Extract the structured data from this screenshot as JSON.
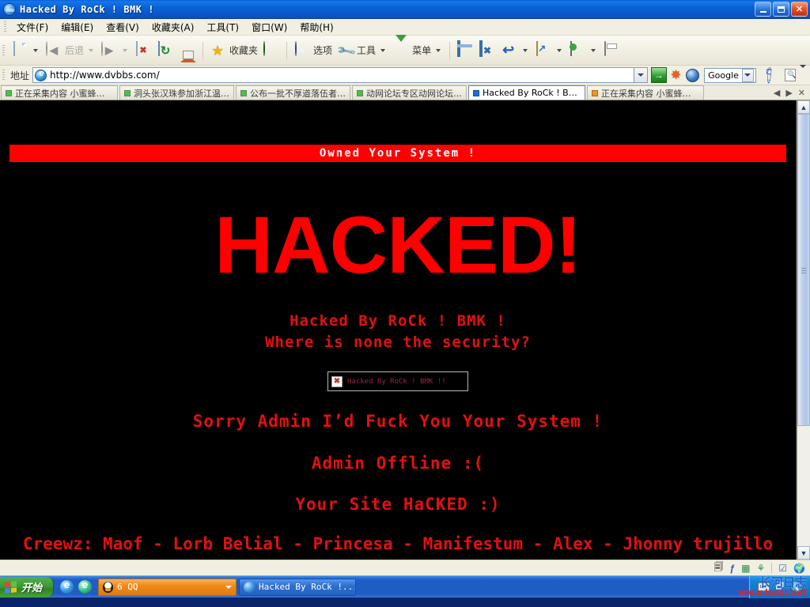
{
  "window": {
    "title": "Hacked By RoCk ! BMK !",
    "icon": "ie-globe-icon",
    "buttons": {
      "minimize": "minimize",
      "maximize": "maximize",
      "close": "close"
    }
  },
  "menubar": {
    "items": [
      {
        "label": "文件(F)"
      },
      {
        "label": "编辑(E)"
      },
      {
        "label": "查看(V)"
      },
      {
        "label": "收藏夹(A)"
      },
      {
        "label": "工具(T)"
      },
      {
        "label": "窗口(W)"
      },
      {
        "label": "帮助(H)"
      }
    ]
  },
  "toolbar": {
    "new_label": "",
    "back_label": "后退",
    "forward_label": "",
    "stop_label": "",
    "refresh_label": "",
    "home_label": "",
    "favorites_label": "收藏夹",
    "sync_label": "",
    "options_label": "选项",
    "tools_label": "工具",
    "menu_label": "菜单",
    "window_label": "",
    "closewin_label": "",
    "undo_label": "",
    "upload_label": "",
    "net_label": "",
    "print_label": ""
  },
  "address": {
    "label": "地址",
    "url": "http://www.dvbbs.com/",
    "placeholder": "http://",
    "go_label": "→",
    "search_engine": "Google"
  },
  "tabs": {
    "items": [
      {
        "label": "正在采集内容 小蜜蜂文…",
        "dot": "green",
        "active": false
      },
      {
        "label": "洞头张汉珠参加浙江温…",
        "dot": "green",
        "active": false
      },
      {
        "label": "公布一批不厚道落伍者…",
        "dot": "green",
        "active": false
      },
      {
        "label": "动网论坛专区动网论坛…",
        "dot": "green",
        "active": false
      },
      {
        "label": "Hacked By RoCk ! BMK !",
        "dot": "blue",
        "active": true
      },
      {
        "label": "正在采集内容 小蜜蜂文…",
        "dot": "orange",
        "active": false
      }
    ],
    "nav": {
      "prev": "◀",
      "next": "▶",
      "close": "✕"
    }
  },
  "page": {
    "banner": "Owned Your System !",
    "headline": "HACKED!",
    "sub_line1": "Hacked By RoCk ! BMK !",
    "sub_line2": "Where is none the security?",
    "broken_image_alt": "Hacked By RoCk ! BMK !!",
    "line3": "Sorry Admin I’d Fuck You Your System !",
    "line4": "Admin Offline :(",
    "line5": "Your Site HaCKED :)",
    "credits": "Creewz: Maof - Lorb Belial - Princesa - Manifestum - Alex - Jhonny trujillo",
    "colors": {
      "background": "#000000",
      "banner_bg": "#ff0000",
      "banner_text": "#ffffff",
      "headline": "#ff0000",
      "body_text": "#e31010"
    }
  },
  "scrollbar": {
    "up": "▲",
    "down": "▼"
  },
  "statusbar": {
    "text": "",
    "icons": [
      "copy-icon",
      "lightning-icon",
      "grid-icon",
      "plant-icon",
      "check-icon",
      "globe-icon"
    ]
  },
  "taskbar": {
    "start_label": "开始",
    "quicklaunch": [
      "ie-icon",
      "ie-alt-icon"
    ],
    "items": [
      {
        "label": "6 QQ",
        "icon": "qq-penguin-icon",
        "style": "qq"
      },
      {
        "label": "Hacked By RoCk !...",
        "icon": "ie-globe-icon",
        "style": "ie"
      }
    ],
    "tray": [
      "keyboard-icon",
      "window-icon",
      "show-desktop-icon"
    ]
  },
  "watermark": {
    "cn": "长河日志",
    "en": "www.lossr.net"
  }
}
